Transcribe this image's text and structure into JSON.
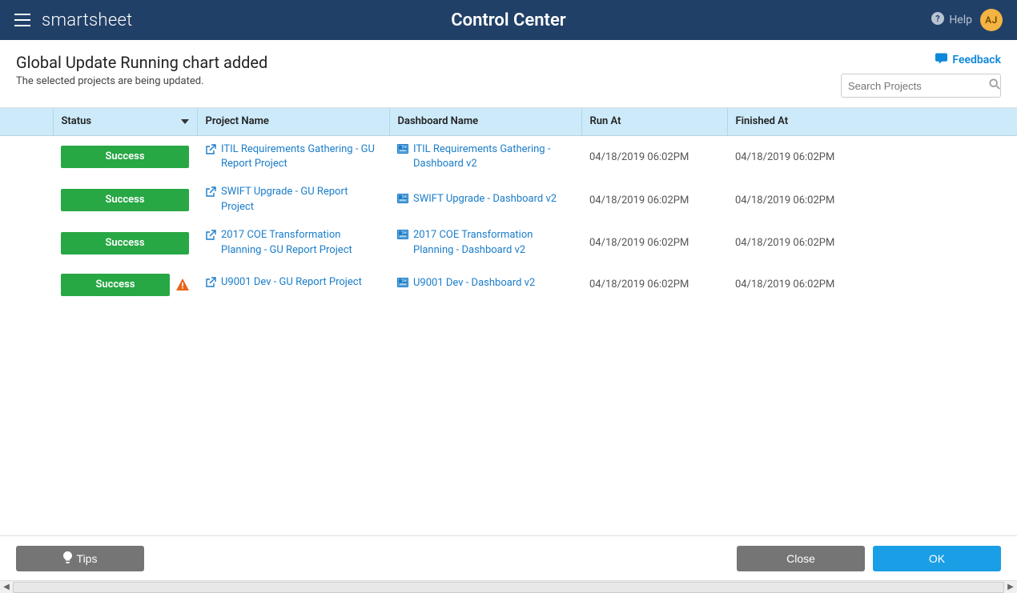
{
  "navbar": {
    "brand": "smartsheet",
    "center_title": "Control Center",
    "help_label": "Help",
    "avatar_initials": "AJ"
  },
  "subheader": {
    "title": "Global Update Running chart added",
    "subtitle": "The selected projects are being updated.",
    "feedback_label": "Feedback",
    "search_placeholder": "Search Projects"
  },
  "table": {
    "headers": {
      "status": "Status",
      "project_name": "Project Name",
      "dashboard_name": "Dashboard Name",
      "run_at": "Run At",
      "finished_at": "Finished At"
    },
    "rows": [
      {
        "status": "Success",
        "warning": false,
        "project_name": "ITIL Requirements Gathering - GU Report Project",
        "dashboard_name": "ITIL Requirements Gathering - Dashboard v2",
        "run_at": "04/18/2019 06:02PM",
        "finished_at": "04/18/2019 06:02PM"
      },
      {
        "status": "Success",
        "warning": false,
        "project_name": "SWIFT Upgrade - GU Report Project",
        "dashboard_name": "SWIFT Upgrade - Dashboard v2",
        "run_at": "04/18/2019 06:02PM",
        "finished_at": "04/18/2019 06:02PM"
      },
      {
        "status": "Success",
        "warning": false,
        "project_name": "2017 COE Transformation Planning - GU Report Project",
        "dashboard_name": "2017 COE Transformation Planning - Dashboard v2",
        "run_at": "04/18/2019 06:02PM",
        "finished_at": "04/18/2019 06:02PM"
      },
      {
        "status": "Success",
        "warning": true,
        "project_name": "U9001 Dev - GU Report Project",
        "dashboard_name": "U9001 Dev - Dashboard v2",
        "run_at": "04/18/2019 06:02PM",
        "finished_at": "04/18/2019 06:02PM"
      }
    ]
  },
  "footer": {
    "tips_label": "Tips",
    "close_label": "Close",
    "ok_label": "OK"
  }
}
